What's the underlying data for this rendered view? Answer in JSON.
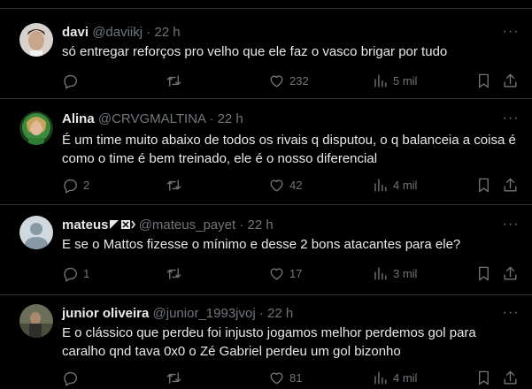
{
  "tweets": [
    {
      "name": "davi",
      "handle": "@daviikj",
      "dot": "·",
      "time": "22 h",
      "text": "só entregar reforços pro velho que ele faz o vasco brigar por tudo",
      "replies": "",
      "retweets": "",
      "likes": "232",
      "views": "5 mil"
    },
    {
      "name": "Alina",
      "handle": "@CRVGMALTINA",
      "dot": "·",
      "time": "22 h",
      "text": "É um time muito abaixo de todos os rivais q disputou, o q balanceia a coisa é como o time é bem treinado, ele é o nosso diferencial",
      "replies": "2",
      "retweets": "",
      "likes": "42",
      "views": "4 mil"
    },
    {
      "name": "mateus",
      "handle": "@mateus_payet",
      "dot": "·",
      "time": "22 h",
      "text": "E se o Mattos fizesse o mínimo e desse 2 bons atacantes para ele?",
      "replies": "1",
      "retweets": "",
      "likes": "17",
      "views": "3 mil"
    },
    {
      "name": "junior oliveira",
      "handle": "@junior_1993jvoj",
      "dot": "·",
      "time": "22 h",
      "text": "E o clássico que perdeu foi injusto jogamos melhor perdemos gol para caralho qnd tava 0x0 o Zé Gabriel perdeu um gol bizonho",
      "replies": "",
      "retweets": "",
      "likes": "81",
      "views": "4 mil"
    }
  ],
  "colors": {
    "background": "#000000",
    "text": "#e7e9ea",
    "muted": "#71767b",
    "border": "#2f3336"
  },
  "icons": [
    "reply-icon",
    "retweet-icon",
    "like-icon",
    "views-icon",
    "bookmark-icon",
    "share-icon",
    "more-icon"
  ]
}
